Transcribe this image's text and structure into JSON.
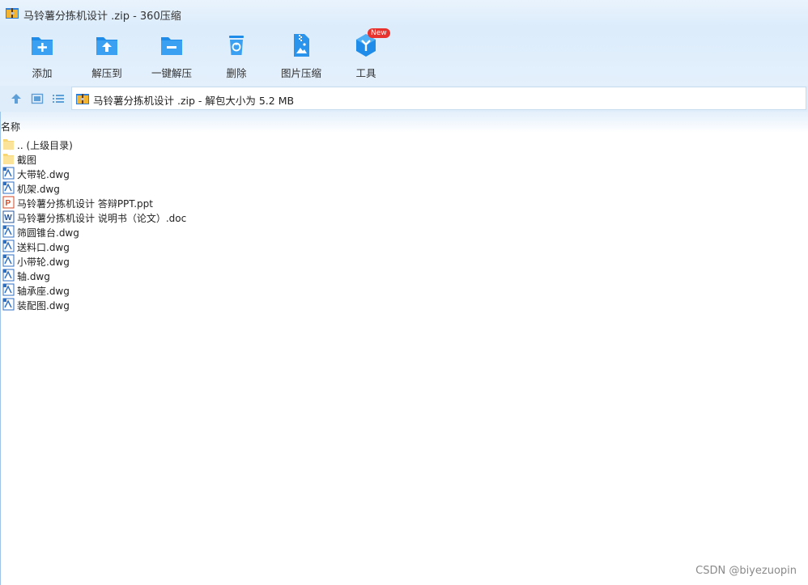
{
  "window": {
    "title": "马铃薯分拣机设计 .zip - 360压缩"
  },
  "toolbar": {
    "items": [
      {
        "label": "添加",
        "icon": "add-folder-icon"
      },
      {
        "label": "解压到",
        "icon": "extract-to-icon"
      },
      {
        "label": "一键解压",
        "icon": "one-click-extract-icon"
      },
      {
        "label": "删除",
        "icon": "trash-icon"
      },
      {
        "label": "图片压缩",
        "icon": "image-compress-icon"
      },
      {
        "label": "工具",
        "icon": "tools-icon",
        "badge": "New"
      }
    ]
  },
  "address_bar": {
    "path": "马铃薯分拣机设计 .zip - 解包大小为 5.2 MB"
  },
  "file_list": {
    "column_header": "名称",
    "files": [
      {
        "name": ".. (上级目录)",
        "type": "folder"
      },
      {
        "name": "截图",
        "type": "folder"
      },
      {
        "name": "大带轮.dwg",
        "type": "dwg"
      },
      {
        "name": "机架.dwg",
        "type": "dwg"
      },
      {
        "name": "马铃薯分拣机设计 答辩PPT.ppt",
        "type": "ppt"
      },
      {
        "name": "马铃薯分拣机设计 说明书（论文）.doc",
        "type": "doc"
      },
      {
        "name": "筛圆锥台.dwg",
        "type": "dwg"
      },
      {
        "name": "送料口.dwg",
        "type": "dwg"
      },
      {
        "name": "小带轮.dwg",
        "type": "dwg"
      },
      {
        "name": "轴.dwg",
        "type": "dwg"
      },
      {
        "name": "轴承座.dwg",
        "type": "dwg"
      },
      {
        "name": "装配图.dwg",
        "type": "dwg"
      }
    ]
  },
  "watermark": "CSDN @biyezuopin",
  "colors": {
    "accent": "#1e8ce8",
    "toolbar_bg": "#dcecfb",
    "badge": "#e8322d"
  }
}
